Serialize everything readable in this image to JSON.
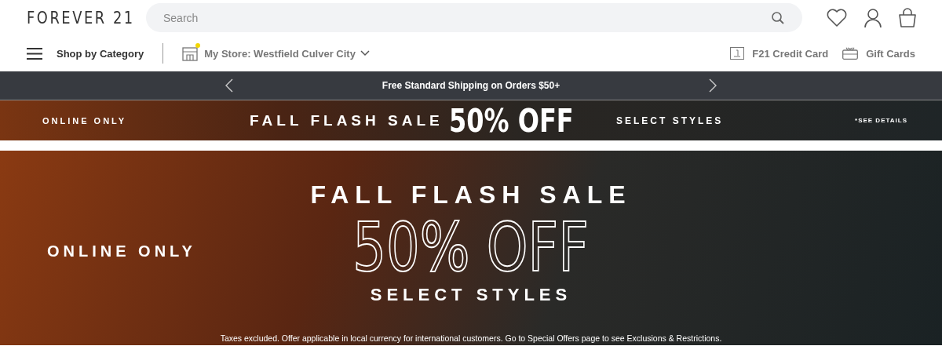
{
  "logo": "FOREVER 21",
  "search": {
    "placeholder": "Search"
  },
  "nav": {
    "category": "Shop by Category",
    "store": "My Store: Westfield Culver City",
    "store_alert": true,
    "links": [
      {
        "kind": "credit",
        "label": "F21 Credit Card"
      },
      {
        "kind": "gift",
        "label": "Gift Cards"
      }
    ]
  },
  "shipping_bar": {
    "message": "Free Standard Shipping on Orders $50+"
  },
  "promo_strip": {
    "left": "ONLINE ONLY",
    "title": "FALL FLASH SALE",
    "discount": "50% OFF",
    "subtitle": "SELECT STYLES",
    "details": "*SEE DETAILS"
  },
  "hero": {
    "left": "ONLINE ONLY",
    "title": "FALL FLASH SALE",
    "discount": "50% OFF",
    "subtitle": "SELECT STYLES",
    "disclaimer": "Taxes excluded. Offer applicable in local currency for international customers. Go to Special Offers page to see Exclusions & Restrictions."
  }
}
